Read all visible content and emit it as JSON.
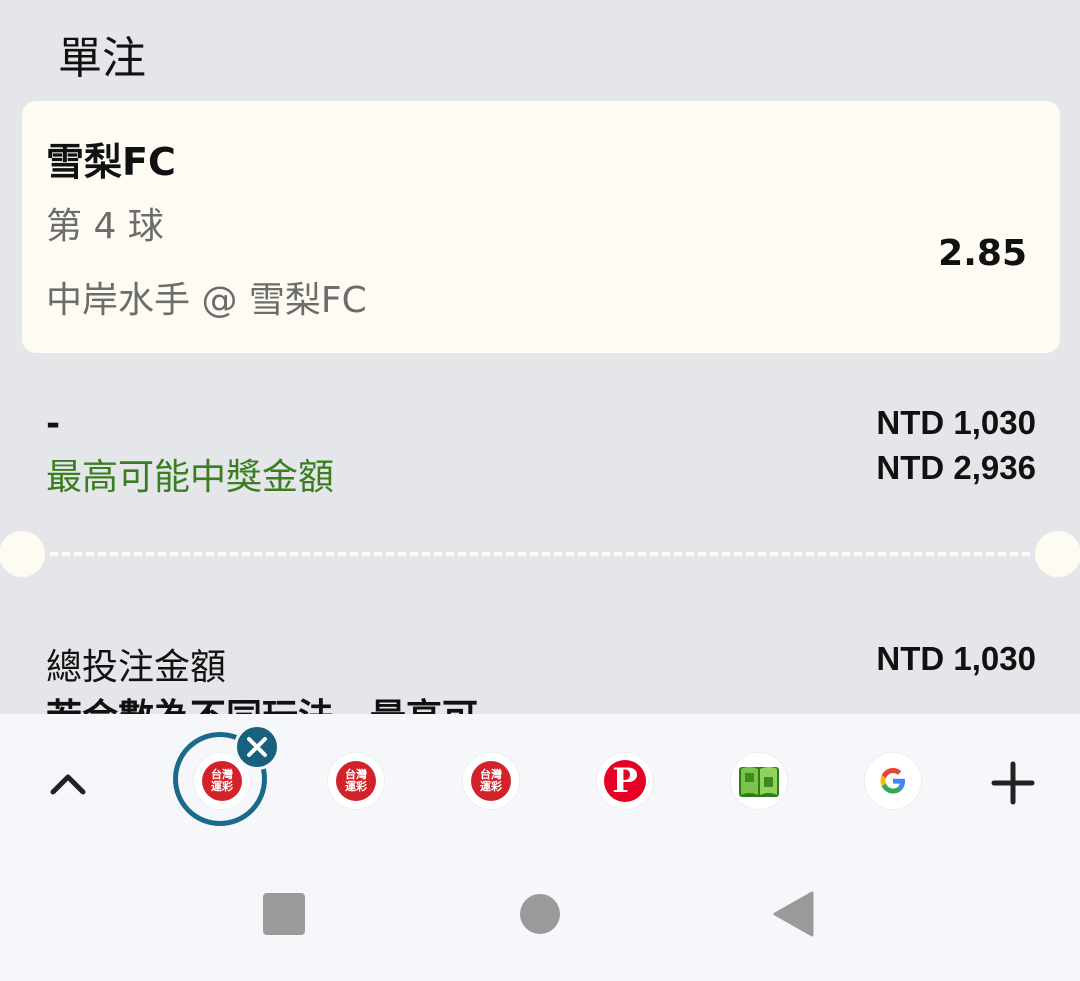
{
  "section": {
    "title": "單注"
  },
  "bet": {
    "team": "雪梨FC",
    "market": "第 4 球",
    "selection": "中岸水手 @ 雪梨FC",
    "odds": "2.85"
  },
  "summary": {
    "stake_label": "-",
    "stake_amount": "NTD 1,030",
    "potential_win_label": "最高可能中獎金額",
    "potential_win_amount": "NTD 2,936",
    "total_stake_label": "總投注金額",
    "total_stake_amount": "NTD 1,030",
    "note_partial": "若合數為不同玩法，最高可"
  },
  "tabbar": {
    "tabs": [
      {
        "name": "台灣運彩",
        "logo_text": "台灣\n運彩",
        "active": true
      },
      {
        "name": "台灣運彩",
        "logo_text": "台灣\n運彩",
        "active": false
      },
      {
        "name": "台灣運彩",
        "logo_text": "台灣\n運彩",
        "active": false
      },
      {
        "name": "pinterest",
        "logo_text": "P",
        "active": false
      },
      {
        "name": "book",
        "logo_text": "",
        "active": false
      },
      {
        "name": "google",
        "logo_text": "G",
        "active": false
      }
    ]
  },
  "colors": {
    "background": "#e4e6e9",
    "card": "#fefcf2",
    "accent_green": "#3a7d22",
    "active_ring": "#1a6a8a",
    "brand_red": "#d2232a"
  }
}
